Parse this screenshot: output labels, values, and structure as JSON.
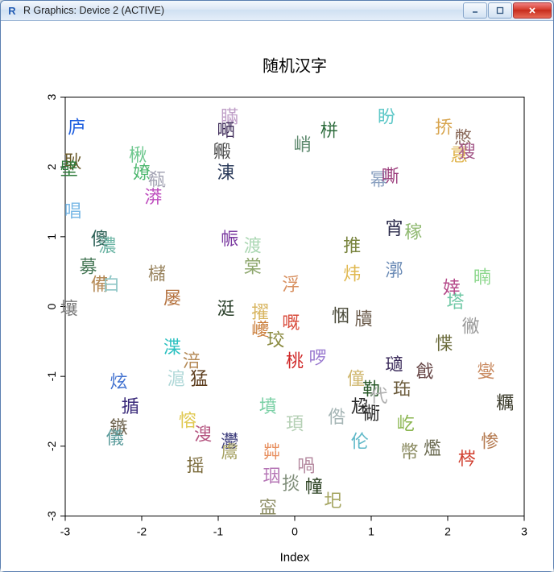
{
  "window": {
    "title": "R Graphics: Device 2 (ACTIVE)",
    "app_icon_letter": "R",
    "controls": {
      "min": "minimize",
      "max": "maximize",
      "close": "close"
    }
  },
  "chart_data": {
    "type": "scatter",
    "title": "随机汉字",
    "xlabel": "Index",
    "ylabel": "",
    "xlim": [
      -3,
      3
    ],
    "ylim": [
      -3,
      3
    ],
    "xticks": [
      -3,
      -2,
      -1,
      0,
      1,
      2,
      3
    ],
    "yticks": [
      -3,
      -2,
      -1,
      0,
      1,
      2,
      3
    ],
    "points": [
      {
        "x": -2.85,
        "y": 2.55,
        "char": "庐",
        "color": "#1f5fe0"
      },
      {
        "x": -2.9,
        "y": 2.05,
        "char": "耿",
        "color": "#6b5a2a"
      },
      {
        "x": -2.95,
        "y": 1.95,
        "char": "壁",
        "color": "#2e7a3a"
      },
      {
        "x": -2.9,
        "y": 1.35,
        "char": "唱",
        "color": "#7ab8e6"
      },
      {
        "x": -2.55,
        "y": 0.95,
        "char": "傻",
        "color": "#2b5f55"
      },
      {
        "x": -2.7,
        "y": 0.55,
        "char": "募",
        "color": "#4a7a5a"
      },
      {
        "x": -2.55,
        "y": 0.3,
        "char": "備",
        "color": "#b58a57"
      },
      {
        "x": -2.4,
        "y": 0.3,
        "char": "白",
        "color": "#8ec6c6"
      },
      {
        "x": -2.95,
        "y": -0.05,
        "char": "壤",
        "color": "#7a7a7a"
      },
      {
        "x": -2.3,
        "y": -1.1,
        "char": "炫",
        "color": "#4272d0"
      },
      {
        "x": -2.15,
        "y": -1.45,
        "char": "揗",
        "color": "#3a2a7a"
      },
      {
        "x": -2.3,
        "y": -1.75,
        "char": "鏃",
        "color": "#6a5f4a"
      },
      {
        "x": -2.35,
        "y": -1.9,
        "char": "儀",
        "color": "#5d9d9d"
      },
      {
        "x": -2.45,
        "y": 0.85,
        "char": "濃",
        "color": "#6db5a5"
      },
      {
        "x": -2.05,
        "y": 2.15,
        "char": "楸",
        "color": "#6fc88f"
      },
      {
        "x": -2.0,
        "y": 1.9,
        "char": "嫽",
        "color": "#4fb870"
      },
      {
        "x": -1.8,
        "y": 1.8,
        "char": "瓻",
        "color": "#a5a5b5"
      },
      {
        "x": -1.85,
        "y": 1.55,
        "char": "漭",
        "color": "#bf4fbf"
      },
      {
        "x": -1.8,
        "y": 0.45,
        "char": "櫧",
        "color": "#9a8560"
      },
      {
        "x": -1.6,
        "y": 0.1,
        "char": "屡",
        "color": "#b57340"
      },
      {
        "x": -1.6,
        "y": -0.6,
        "char": "渫",
        "color": "#2ac0c0"
      },
      {
        "x": -1.35,
        "y": -0.8,
        "char": "涪",
        "color": "#b58a57"
      },
      {
        "x": -1.55,
        "y": -1.05,
        "char": "滬",
        "color": "#b0d8d8"
      },
      {
        "x": -1.25,
        "y": -1.05,
        "char": "猛",
        "color": "#5a3a1a"
      },
      {
        "x": -1.4,
        "y": -1.65,
        "char": "愹",
        "color": "#e0C850"
      },
      {
        "x": -1.2,
        "y": -1.85,
        "char": "溲",
        "color": "#b55580"
      },
      {
        "x": -1.3,
        "y": -2.3,
        "char": "摇",
        "color": "#7a6a3a"
      },
      {
        "x": -0.85,
        "y": 2.7,
        "char": "瞞",
        "color": "#c0a0c8"
      },
      {
        "x": -0.9,
        "y": 2.5,
        "char": "嗮",
        "color": "#3d2a58"
      },
      {
        "x": -0.95,
        "y": 2.2,
        "char": "毈",
        "color": "#4a4a4a"
      },
      {
        "x": -0.9,
        "y": 1.9,
        "char": "涷",
        "color": "#2a3a5a"
      },
      {
        "x": -0.85,
        "y": 0.95,
        "char": "帪",
        "color": "#7a3aa0"
      },
      {
        "x": -0.9,
        "y": -0.05,
        "char": "涏",
        "color": "#2a402a"
      },
      {
        "x": -0.85,
        "y": -1.95,
        "char": "灪",
        "color": "#3a3a7a"
      },
      {
        "x": -0.85,
        "y": -2.1,
        "char": "鬳",
        "color": "#a5a060"
      },
      {
        "x": -0.55,
        "y": 0.85,
        "char": "渡",
        "color": "#add8b5"
      },
      {
        "x": -0.55,
        "y": 0.55,
        "char": "棠",
        "color": "#8fa86f"
      },
      {
        "x": -0.45,
        "y": -0.1,
        "char": "擢",
        "color": "#d8b560"
      },
      {
        "x": -0.45,
        "y": -0.35,
        "char": "巙",
        "color": "#c97a35"
      },
      {
        "x": -0.25,
        "y": -0.5,
        "char": "珓",
        "color": "#8a8a40"
      },
      {
        "x": -0.35,
        "y": -1.45,
        "char": "墳",
        "color": "#7ad0a5"
      },
      {
        "x": -0.3,
        "y": -2.1,
        "char": "茻",
        "color": "#e89060"
      },
      {
        "x": -0.3,
        "y": -2.45,
        "char": "珚",
        "color": "#b575b5"
      },
      {
        "x": -0.35,
        "y": -2.9,
        "char": "寍",
        "color": "#8a8a60"
      },
      {
        "x": -0.05,
        "y": 0.3,
        "char": "浮",
        "color": "#d89060"
      },
      {
        "x": -0.05,
        "y": -0.25,
        "char": "嘅",
        "color": "#d84a3a"
      },
      {
        "x": 0.0,
        "y": -0.8,
        "char": "桃",
        "color": "#d02a2a"
      },
      {
        "x": 0.0,
        "y": -1.7,
        "char": "頊",
        "color": "#b5d0b5"
      },
      {
        "x": -0.05,
        "y": -2.55,
        "char": "掞",
        "color": "#808e7a"
      },
      {
        "x": 0.1,
        "y": 2.3,
        "char": "峭",
        "color": "#5f8a6f"
      },
      {
        "x": 0.15,
        "y": -2.3,
        "char": "喎",
        "color": "#b58aa0"
      },
      {
        "x": 0.3,
        "y": -0.75,
        "char": "啰",
        "color": "#9a7ad0"
      },
      {
        "x": 0.25,
        "y": -2.6,
        "char": "幢",
        "color": "#2a4020"
      },
      {
        "x": 0.45,
        "y": 2.5,
        "char": "栟",
        "color": "#2a6a3a"
      },
      {
        "x": 0.5,
        "y": -2.8,
        "char": "圯",
        "color": "#a5a560"
      },
      {
        "x": 0.55,
        "y": -1.6,
        "char": "倃",
        "color": "#a5b5b5"
      },
      {
        "x": 0.6,
        "y": -0.15,
        "char": "悃",
        "color": "#4a4a3a"
      },
      {
        "x": 0.75,
        "y": 0.85,
        "char": "推",
        "color": "#7a8540"
      },
      {
        "x": 0.75,
        "y": 0.45,
        "char": "炜",
        "color": "#e0b84f"
      },
      {
        "x": 0.8,
        "y": -1.05,
        "char": "僮",
        "color": "#d0b870"
      },
      {
        "x": 0.85,
        "y": -1.95,
        "char": "伦",
        "color": "#5fb8c8"
      },
      {
        "x": 0.85,
        "y": -1.45,
        "char": "尮",
        "color": "#2a2a2a"
      },
      {
        "x": 0.9,
        "y": -0.2,
        "char": "牘",
        "color": "#6a5a4a"
      },
      {
        "x": 1.0,
        "y": -1.55,
        "char": "衚",
        "color": "#2a2a2a"
      },
      {
        "x": 1.0,
        "y": -1.2,
        "char": "勒",
        "color": "#2a5a2a"
      },
      {
        "x": 1.1,
        "y": -1.3,
        "char": "代",
        "color": "#b0b0b0"
      },
      {
        "x": 1.1,
        "y": 1.8,
        "char": "幂",
        "color": "#8aa0c0"
      },
      {
        "x": 1.2,
        "y": 2.7,
        "char": "盼",
        "color": "#5fc8c8"
      },
      {
        "x": 1.25,
        "y": 1.85,
        "char": "嘶",
        "color": "#9a3a7a"
      },
      {
        "x": 1.3,
        "y": 0.5,
        "char": "漷",
        "color": "#6a8ab5"
      },
      {
        "x": 1.3,
        "y": 1.1,
        "char": "宵",
        "color": "#2a2a4a"
      },
      {
        "x": 1.3,
        "y": -0.85,
        "char": "瓋",
        "color": "#3a2a5a"
      },
      {
        "x": 1.4,
        "y": -1.2,
        "char": "珤",
        "color": "#6a5a3a"
      },
      {
        "x": 1.45,
        "y": -1.7,
        "char": "屹",
        "color": "#8ab54f"
      },
      {
        "x": 1.5,
        "y": -2.1,
        "char": "幣",
        "color": "#8a8a60"
      },
      {
        "x": 1.55,
        "y": 1.05,
        "char": "稼",
        "color": "#8fb970"
      },
      {
        "x": 1.7,
        "y": -0.95,
        "char": "戧",
        "color": "#6a4a4a"
      },
      {
        "x": 1.8,
        "y": -2.05,
        "char": "爁",
        "color": "#6a6a50"
      },
      {
        "x": 1.95,
        "y": -0.55,
        "char": "惵",
        "color": "#6a6a3a"
      },
      {
        "x": 1.95,
        "y": 2.55,
        "char": "挢",
        "color": "#d8a54f"
      },
      {
        "x": 2.05,
        "y": 0.25,
        "char": "婞",
        "color": "#b54a8a"
      },
      {
        "x": 2.1,
        "y": 0.05,
        "char": "塔",
        "color": "#6fc8a5"
      },
      {
        "x": 2.15,
        "y": 2.15,
        "char": "慐",
        "color": "#e0b54f"
      },
      {
        "x": 2.2,
        "y": 2.4,
        "char": "憋",
        "color": "#8a6a5a"
      },
      {
        "x": 2.25,
        "y": 2.2,
        "char": "獀",
        "color": "#a55a8a"
      },
      {
        "x": 2.25,
        "y": -2.2,
        "char": "梣",
        "color": "#d03a2a"
      },
      {
        "x": 2.3,
        "y": -0.3,
        "char": "徶",
        "color": "#9a9a9a"
      },
      {
        "x": 2.45,
        "y": 0.4,
        "char": "暔",
        "color": "#8fd88f"
      },
      {
        "x": 2.5,
        "y": -0.95,
        "char": "燮",
        "color": "#c98a60"
      },
      {
        "x": 2.55,
        "y": -1.95,
        "char": "惨",
        "color": "#b57a50"
      },
      {
        "x": 2.75,
        "y": -1.4,
        "char": "糲",
        "color": "#3a3a2a"
      }
    ]
  }
}
